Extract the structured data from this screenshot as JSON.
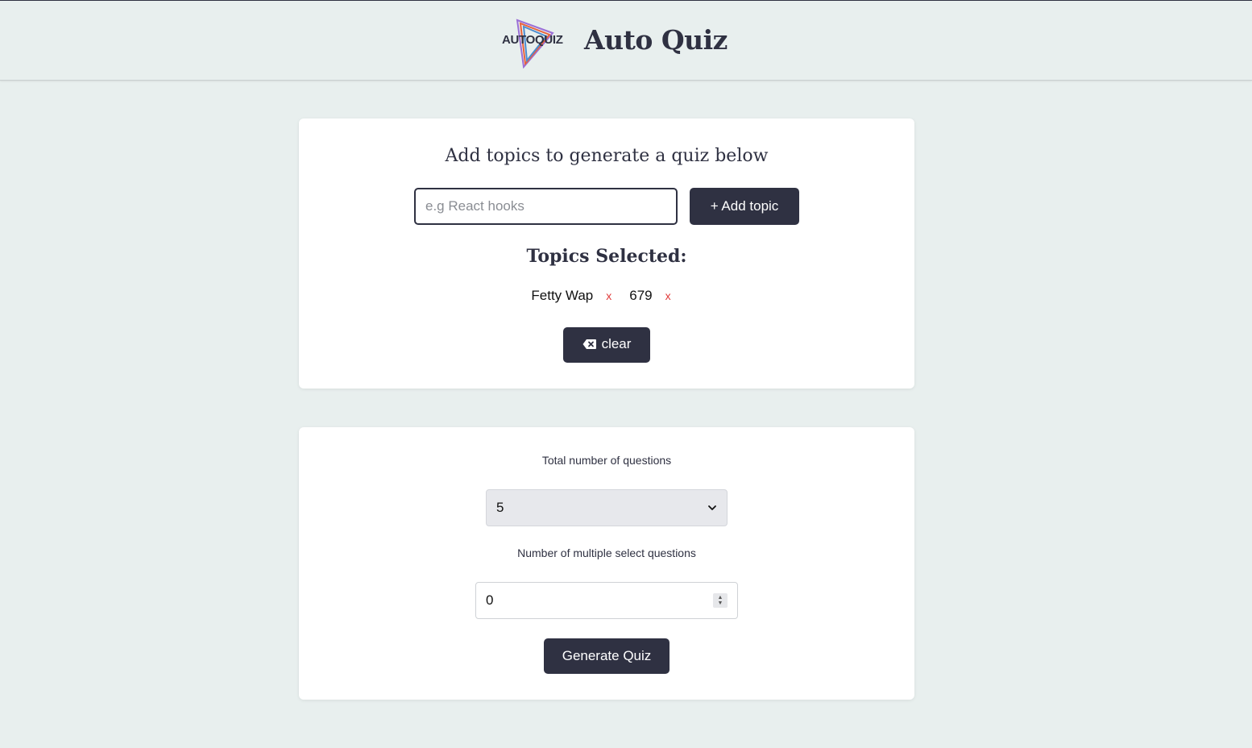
{
  "header": {
    "logo_text": "AUTOQUIZ",
    "title": "Auto Quiz"
  },
  "topics_card": {
    "heading": "Add topics to generate a quiz below",
    "input_placeholder": "e.g React hooks",
    "input_value": "",
    "add_button_label": "+ Add topic",
    "selected_heading": "Topics Selected:",
    "topics": [
      {
        "label": "Fetty Wap",
        "remove_label": "x"
      },
      {
        "label": "679",
        "remove_label": "x"
      }
    ],
    "clear_button_label": "clear"
  },
  "settings_card": {
    "total_label": "Total number of questions",
    "total_selected": "5",
    "multi_label": "Number of multiple select questions",
    "multi_value": "0",
    "generate_button_label": "Generate Quiz"
  },
  "colors": {
    "page_bg": "#e8efee",
    "dark": "#2f3142",
    "remove_red": "#e03a3a"
  }
}
